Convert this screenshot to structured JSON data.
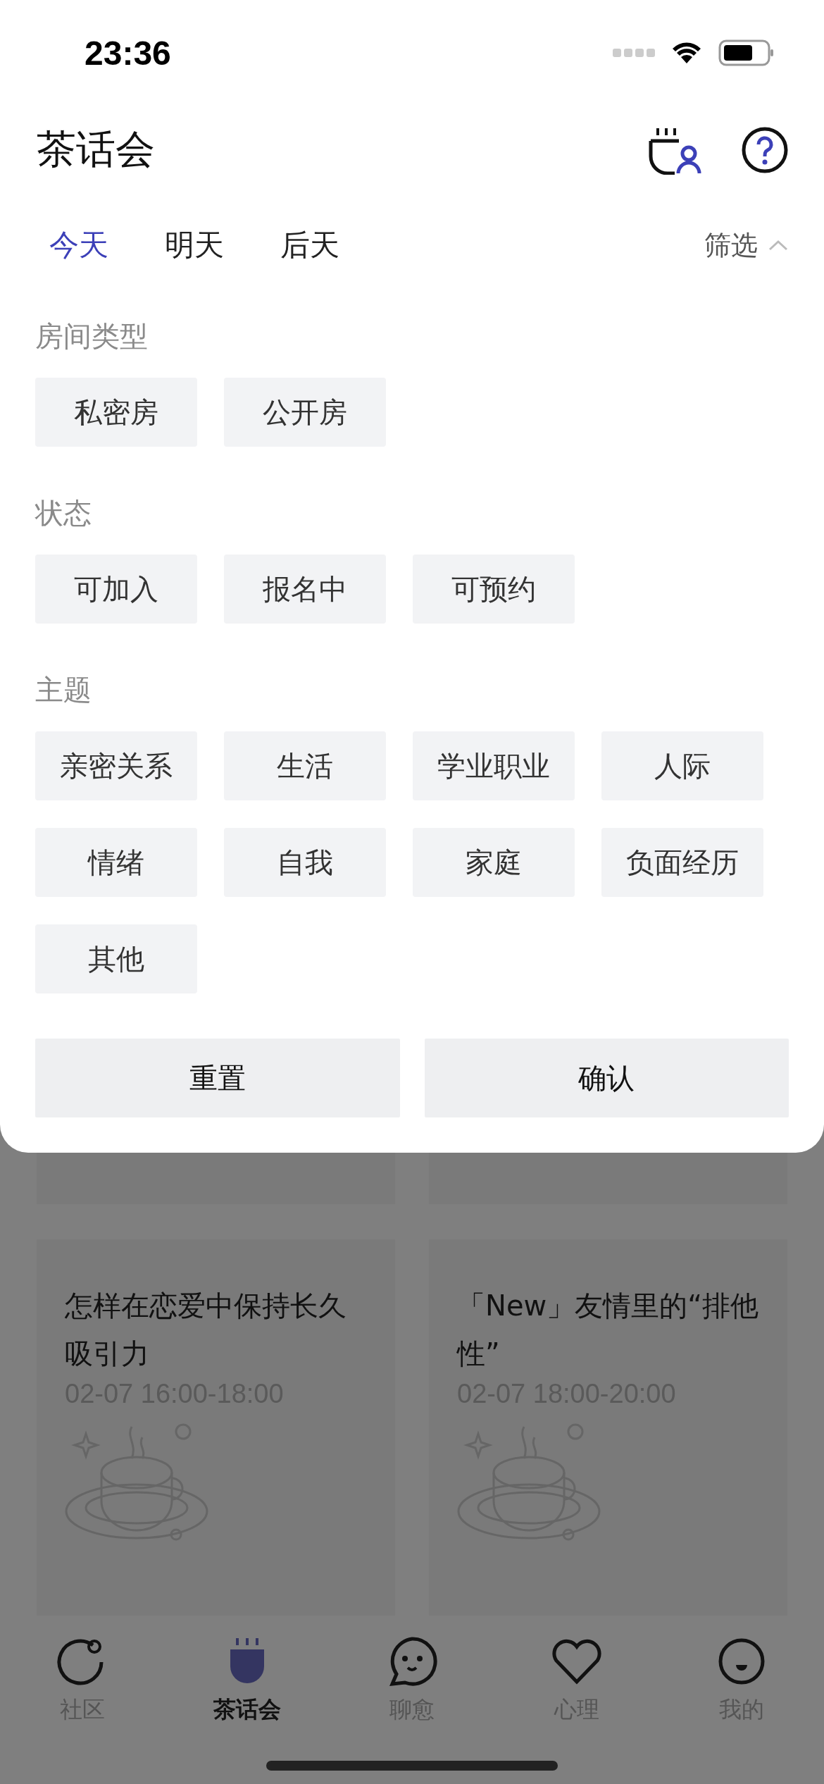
{
  "status_bar": {
    "time": "23:36"
  },
  "header": {
    "title": "茶话会"
  },
  "day_tabs": [
    {
      "label": "今天",
      "selected": true
    },
    {
      "label": "明天",
      "selected": false
    },
    {
      "label": "后天",
      "selected": false
    }
  ],
  "filter": {
    "label": "筛选",
    "expanded": true
  },
  "filter_sheet": {
    "sections": [
      {
        "title": "房间类型",
        "options": [
          "私密房",
          "公开房"
        ]
      },
      {
        "title": "状态",
        "options": [
          "可加入",
          "报名中",
          "可预约"
        ]
      },
      {
        "title": "主题",
        "options": [
          "亲密关系",
          "生活",
          "学业职业",
          "人际",
          "情绪",
          "自我",
          "家庭",
          "负面经历",
          "其他"
        ]
      }
    ],
    "buttons": [
      "重置",
      "确认"
    ]
  },
  "sessions": [
    {
      "title": "怎样在恋爱中保持长久吸引力",
      "time": "02-07 16:00-18:00"
    },
    {
      "title": "「New」友情里的“排他性”",
      "time": "02-07 18:00-20:00"
    }
  ],
  "bottom_tabs": [
    {
      "label": "社区",
      "selected": false
    },
    {
      "label": "茶话会",
      "selected": true
    },
    {
      "label": "聊愈",
      "selected": false
    },
    {
      "label": "心理",
      "selected": false
    },
    {
      "label": "我的",
      "selected": false
    }
  ]
}
